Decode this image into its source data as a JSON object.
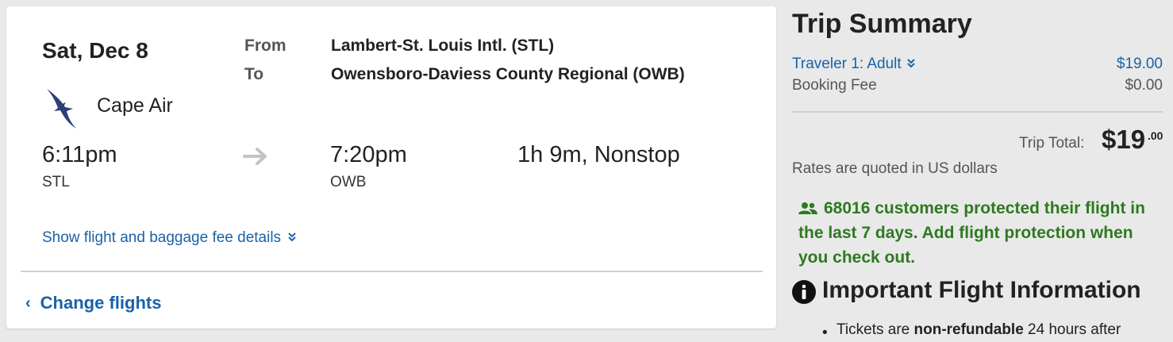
{
  "flight": {
    "date": "Sat, Dec 8",
    "from_label": "From",
    "to_label": "To",
    "from_airport": "Lambert-St. Louis Intl. (STL)",
    "to_airport": "Owensboro-Daviess County Regional (OWB)",
    "airline": "Cape Air",
    "airline_logo_icon": "bird-icon",
    "departure_time": "6:11pm",
    "departure_code": "STL",
    "arrival_time": "7:20pm",
    "arrival_code": "OWB",
    "duration": "1h 9m, Nonstop",
    "details_link": "Show flight and baggage fee details",
    "change_link": "Change flights"
  },
  "summary": {
    "title": "Trip Summary",
    "traveler_label": "Traveler 1: Adult",
    "traveler_price": "$19.00",
    "fee_label": "Booking Fee",
    "fee_price": "$0.00",
    "total_label": "Trip Total:",
    "total_amount": "$19",
    "total_cents": ".00",
    "rates_note": "Rates are quoted in US dollars",
    "protection_text": "68016 customers protected their flight in the last 7 days. Add flight protection when you check out.",
    "info_title": "Important Flight Information",
    "info_bullet_partial": "Tickets are non-refundable 24 hours after"
  },
  "colors": {
    "link": "#1a62a8",
    "success": "#2d7a1f",
    "background": "#e9e9e9"
  }
}
